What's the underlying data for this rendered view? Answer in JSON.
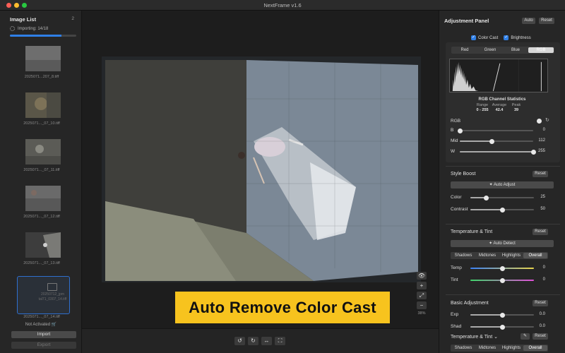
{
  "window": {
    "title": "NextFrame v1.6"
  },
  "sidebar": {
    "title": "Image List",
    "count": "2",
    "import_status": "Importing: 14/18",
    "import_progress": 0.78,
    "thumbnails": [
      {
        "label": "2025071...207_8.tiff"
      },
      {
        "label": "2025071..._07_10.tiff"
      },
      {
        "label": "2025071..._07_11.tiff"
      },
      {
        "label": "2025071..._07_12.tiff"
      },
      {
        "label": "2025071..._07_13.tiff"
      },
      {
        "label": "2025071..._07_14.tiff",
        "placeholder_text": "20250712_jpm tal71_0307_14.tiff",
        "selected": true
      }
    ],
    "activation": "Not Activated",
    "import_button": "Import",
    "export_button": "Export"
  },
  "canvas": {
    "banner": "Auto Remove Color Cast",
    "zoom": "38%",
    "zoom_in": "+",
    "zoom_out": "−"
  },
  "right_panel": {
    "title": "Adjustment Panel",
    "auto_button": "Auto",
    "reset_button": "Reset",
    "color_cast_label": "Color Cast",
    "brightness_label": "Brightness",
    "channels": [
      "Red",
      "Green",
      "Blue",
      "RGB"
    ],
    "active_channel": "RGB",
    "stats": {
      "title": "RGB Channel Statistics",
      "range_label": "Range",
      "range_value": "0 - 255",
      "average_label": "Average",
      "average_value": "42.4",
      "peak_label": "Peak",
      "peak_value": "39"
    },
    "levels": {
      "rgb_label": "RGB",
      "b_label": "B",
      "b_value": "0",
      "mid_label": "Mid",
      "mid_value": "112",
      "w_label": "W",
      "w_value": "255"
    },
    "style_boost": {
      "title": "Style Boost",
      "reset": "Reset",
      "auto_adjust": "Auto Adjust",
      "color_label": "Color",
      "color_value": "25",
      "contrast_label": "Contrast",
      "contrast_value": "50"
    },
    "temp_tint": {
      "title": "Temperature & Tint",
      "reset": "Reset",
      "auto_detect": "Auto Detect",
      "tabs": [
        "Shadows",
        "Midtones",
        "Highlights",
        "Overall"
      ],
      "active_tab": "Overall",
      "temp_label": "Temp",
      "temp_value": "0",
      "tint_label": "Tint",
      "tint_value": "0"
    },
    "basic": {
      "title": "Basic Adjustment",
      "reset": "Reset",
      "exp_label": "Exp",
      "exp_value": "0.0",
      "shad_label": "Shad",
      "shad_value": "0.0",
      "sub_title": "Temperature & Tint",
      "sub_reset": "Reset",
      "tabs": [
        "Shadows",
        "Midtones",
        "Highlights",
        "Overall"
      ],
      "active_tab": "Overall"
    }
  },
  "colors": {
    "accent": "#2f7fe6",
    "banner": "#f7c31e"
  }
}
